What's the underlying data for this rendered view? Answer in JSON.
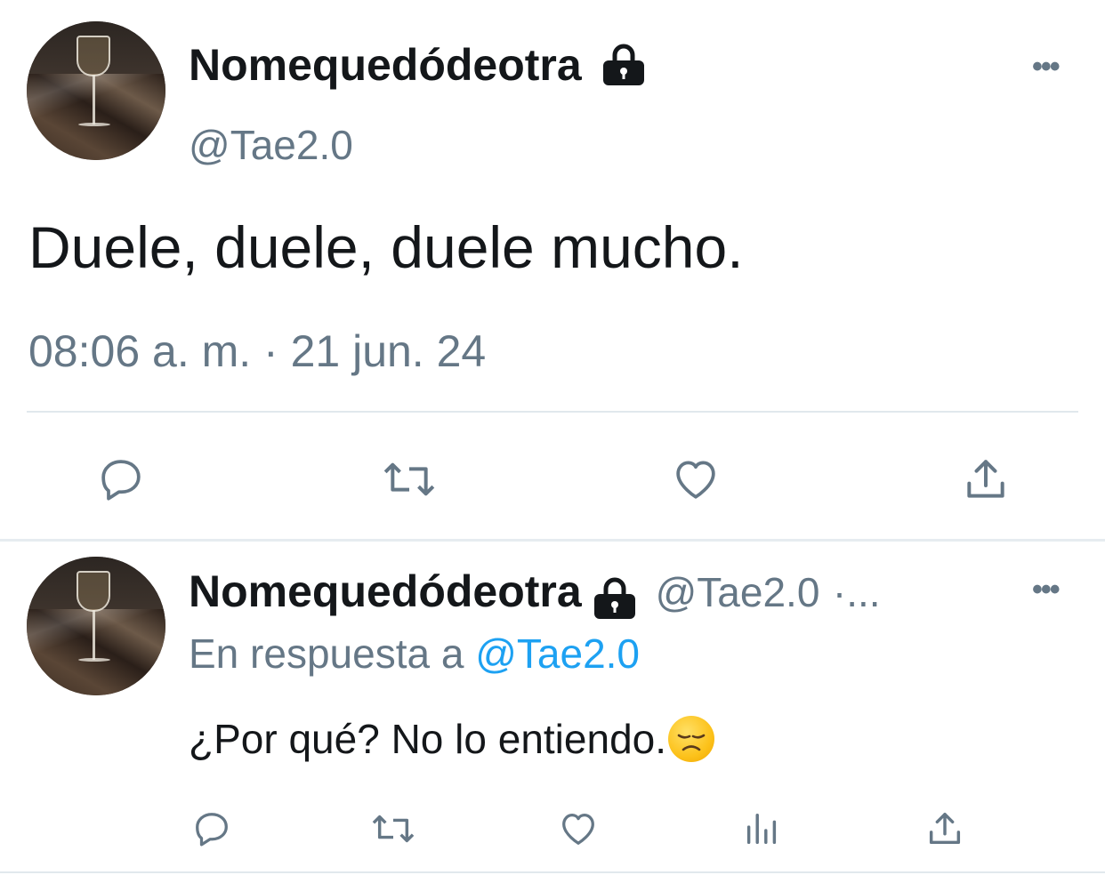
{
  "tweet": {
    "display_name": "Nomequedódeotra",
    "handle": "@Tae2.0",
    "text": "Duele, duele, duele mucho.",
    "timestamp": "08:06 a. m. · 21 jun. 24",
    "more_label": "•••",
    "actions": [
      "reply-icon",
      "retweet-icon",
      "like-icon",
      "share-icon"
    ]
  },
  "reply": {
    "display_name": "Nomequedódeotra",
    "handle": "@Tae2.0",
    "handle_suffix": "·...",
    "reply_prefix": "En respuesta a ",
    "reply_mention": "@Tae2.0",
    "text": "¿Por qué? No lo entiendo.",
    "emoji": "disappointed-face",
    "more_label": "•••",
    "actions": [
      "reply-icon",
      "retweet-icon",
      "like-icon",
      "analytics-icon",
      "share-icon"
    ]
  },
  "colors": {
    "text": "#14171a",
    "secondary": "#657786",
    "link": "#1da1f2",
    "divider": "#e1e8ed"
  }
}
